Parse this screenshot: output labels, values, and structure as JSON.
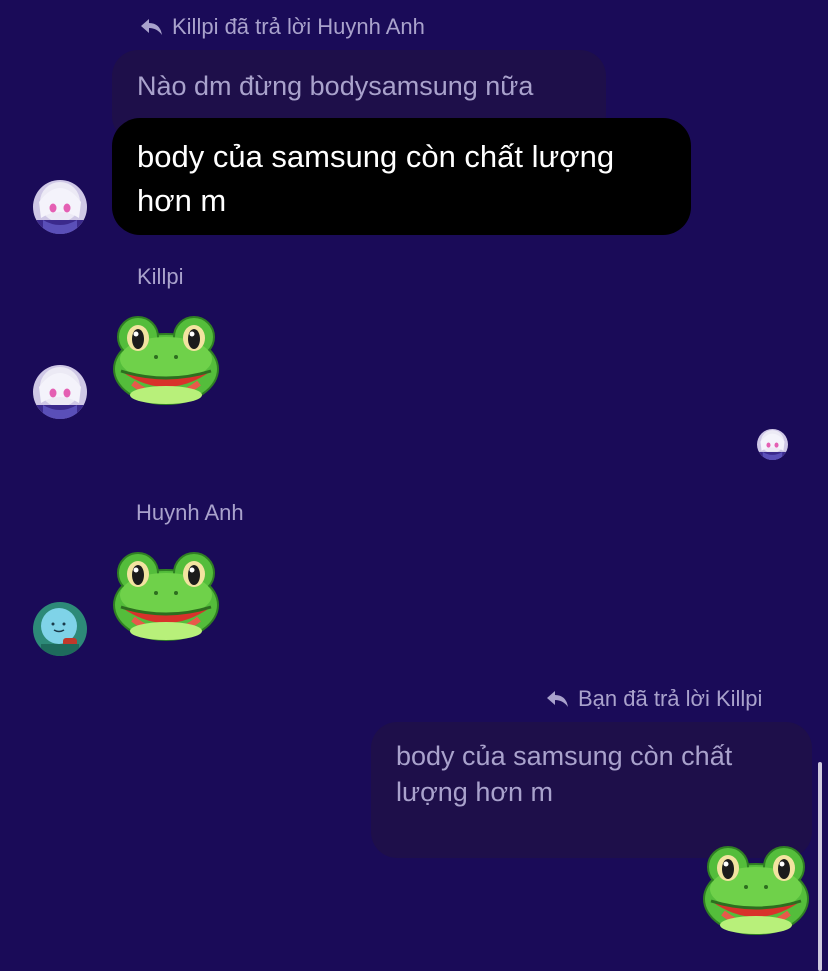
{
  "conversation": {
    "message1": {
      "reply_indicator": "Killpi đã trả lời Huynh Anh",
      "quoted_text": "Nào dm đừng bodysamsung nữa",
      "text": "body của samsung còn chất lượng hơn m",
      "avatar": "anime-girl-avatar"
    },
    "message2": {
      "sender": "Killpi",
      "sticker": "frog-emoji-icon",
      "avatar": "anime-girl-avatar"
    },
    "read_receipt": {
      "avatar": "anime-girl-avatar"
    },
    "message3": {
      "sender": "Huynh Anh",
      "sticker": "frog-emoji-icon",
      "avatar": "cartoon-character-avatar"
    },
    "message4": {
      "reply_indicator": "Bạn đã trả lời Killpi",
      "quoted_text": "body của samsung còn chất lượng hơn m",
      "sticker": "frog-emoji-icon"
    }
  },
  "colors": {
    "background": "#1a0b58",
    "bubble": "#000000",
    "quoted_bubble": "#1e0f4a",
    "muted_text": "#a9a2cc"
  }
}
